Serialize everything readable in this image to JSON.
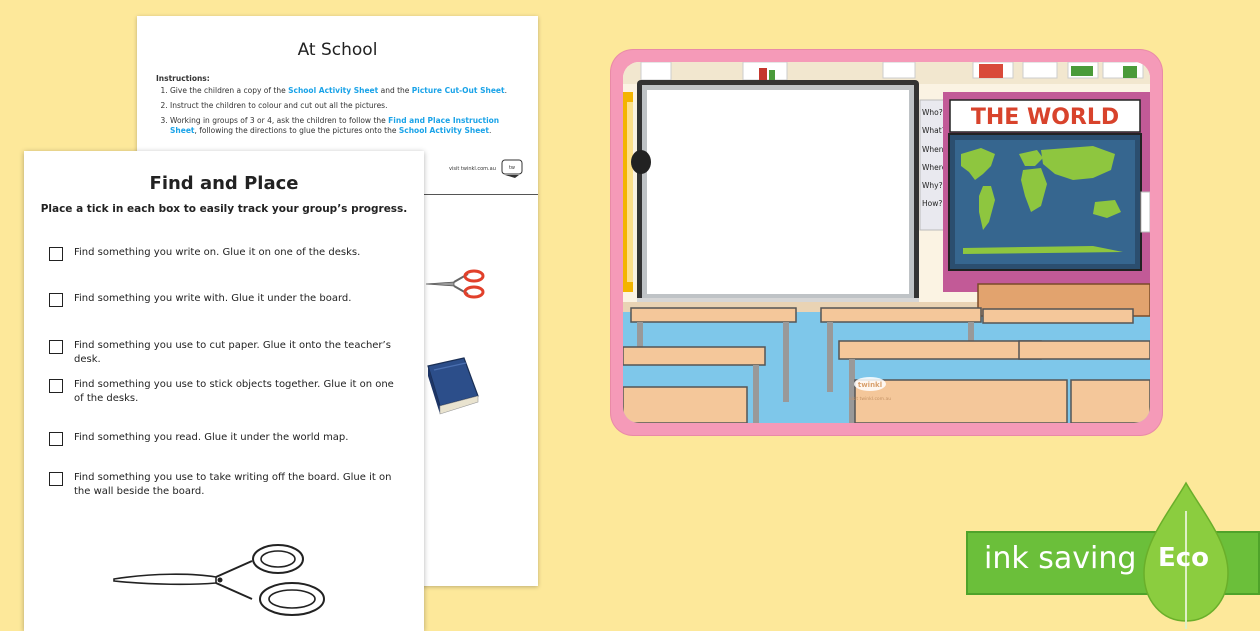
{
  "at_school": {
    "title": "At School",
    "instructions_heading": "Instructions:",
    "step1_a": "Give the children a copy of the ",
    "step1_link1": "School Activity Sheet",
    "step1_b": " and the ",
    "step1_link2": "Picture Cut-Out Sheet",
    "step1_c": ".",
    "step2": "Instruct the children to colour and cut out all the pictures.",
    "step3_a": "Working in groups of 3 or 4, ask the children to follow the ",
    "step3_link1": "Find and Place Instruction Sheet",
    "step3_b": ", following the directions to glue the pictures onto the ",
    "step3_link2": "School Activity Sheet",
    "step3_c": ".",
    "footer_url": "visit twinkl.com.au"
  },
  "find_and_place": {
    "title": "Find and Place",
    "subtitle": "Place a tick in each box to easily track your group’s progress.",
    "tasks": [
      "Find something you write on. Glue it on one of the desks.",
      "Find something you write with. Glue it under the board.",
      "Find something you use to cut paper. Glue it onto the teacher’s desk.",
      "Find something you use to stick objects together. Glue it on one of the desks.",
      "Find something you read. Glue it under the world map.",
      "Find something you use to take writing off the board. Glue it on the wall beside the board."
    ]
  },
  "classroom": {
    "map_title": "THE WORLD",
    "questions": [
      "Who?",
      "What?",
      "When?",
      "Where?",
      "Why?",
      "How?"
    ],
    "watermark": "twinkl",
    "watermark_url": "visit twinkl.com.au"
  },
  "eco_badge": {
    "label": "ink saving",
    "eco": "Eco"
  },
  "colors": {
    "background": "#fde89a",
    "link": "#1aa3e8",
    "frame": "#f59ab8",
    "eco_green": "#6bbf3a"
  }
}
